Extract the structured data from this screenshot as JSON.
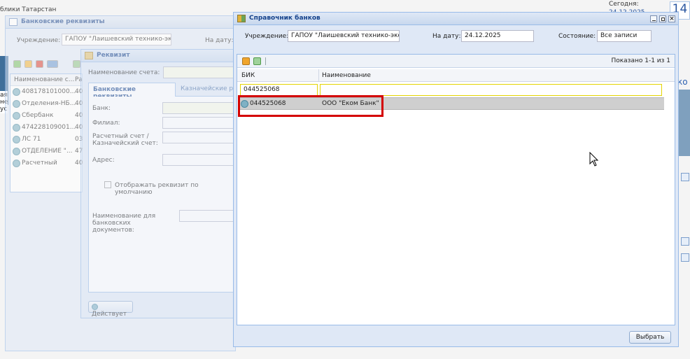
{
  "background": {
    "top_left_text": "блики Татарстан",
    "today_label": "Сегодня:",
    "today_value": "24.12.2025",
    "day_number": "14",
    "right_text_ko": "ко",
    "left_partial_lines": [
      "ая",
      "не",
      "ус"
    ]
  },
  "bank_details_window": {
    "title": "Банковские реквизиты",
    "institution_label": "Учреждение:",
    "institution_value": "ГАПОУ \"Лаишевский технико-экон",
    "date_label": "На дату:",
    "col_name": "Наименование с...",
    "col_rs": "Ра",
    "rows": [
      {
        "name": "408178101000...",
        "code": "40"
      },
      {
        "name": "Отделения-НБ...",
        "code": "40"
      },
      {
        "name": "Сбербанк",
        "code": "40"
      },
      {
        "name": "474228109001...",
        "code": "40"
      },
      {
        "name": "ЛС 71",
        "code": "03"
      },
      {
        "name": "ОТДЕЛЕНИЕ \"...",
        "code": "47"
      },
      {
        "name": "Расчетный",
        "code": "40"
      }
    ]
  },
  "requisite_window": {
    "title": "Реквизит",
    "account_name_label": "Наименование счета:",
    "tab_bank": "Банковские реквизиты",
    "tab_treasury": "Казначейские рекв",
    "bank_label": "Банк:",
    "branch_label": "Филиал:",
    "account_label": "Расчетный счет / Казначейский счет:",
    "address_label": "Адрес:",
    "default_checkbox_label": "Отображать реквизит по умолчанию",
    "doc_name_label": "Наименование для банковских документов:",
    "status_button": "Действует"
  },
  "bank_directory": {
    "title": "Справочник банков",
    "institution_label": "Учреждение:",
    "institution_value": "ГАПОУ \"Лаишевский технико-экон",
    "date_label": "На дату:",
    "date_value": "24.12.2025",
    "state_label": "Состояние:",
    "state_value": "Все записи",
    "shown_text": "Показано 1-1 из 1",
    "col_bik": "БИК",
    "col_name": "Наименование",
    "filter_bik": "044525068",
    "filter_name": "",
    "rows": [
      {
        "bik": "044525068",
        "name": "ООО \"Еком Банк\""
      }
    ],
    "select_button": "Выбрать"
  },
  "colors": {
    "window_border": "#99bbe8",
    "title_text": "#15428b",
    "highlight_red": "#d40000",
    "filter_border": "#e3d400"
  }
}
